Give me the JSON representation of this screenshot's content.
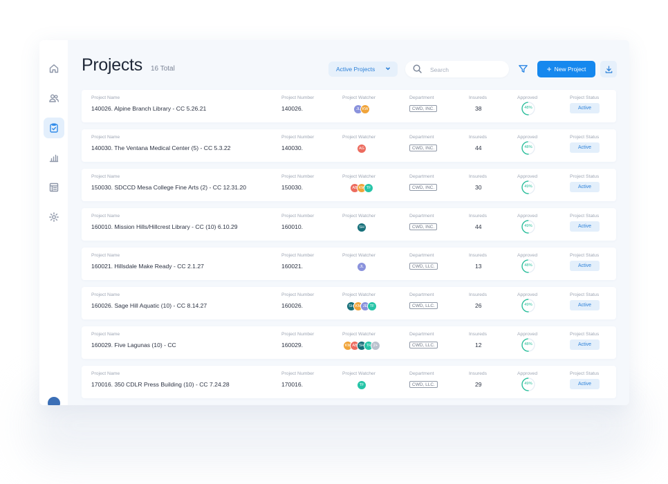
{
  "page": {
    "title": "Projects",
    "total": "16 Total",
    "filter_dropdown": "Active Projects",
    "search_placeholder": "Search",
    "new_project_label": "New Project"
  },
  "sidebar": {
    "items": [
      {
        "icon": "home-icon",
        "active": false
      },
      {
        "icon": "users-icon",
        "active": false
      },
      {
        "icon": "clipboard-check-icon",
        "active": true
      },
      {
        "icon": "bar-chart-icon",
        "active": false
      },
      {
        "icon": "table-list-icon",
        "active": false
      },
      {
        "icon": "settings-icon",
        "active": false
      }
    ]
  },
  "columns": {
    "name": "Project Name",
    "number": "Project Number",
    "watcher": "Project Watcher",
    "department": "Department",
    "insureds": "Insureds",
    "approved": "Approved",
    "status": "Project Status"
  },
  "colors": {
    "accent": "#1688ee",
    "approved_ring": "#2bbf9b"
  },
  "projects": [
    {
      "name": "140026. Alpine Branch Library - CC 5.26.21",
      "number": "140026.",
      "watchers": [
        {
          "initials": "JL",
          "color": "#8a92dc"
        },
        {
          "initials": "KW",
          "color": "#f0a43a"
        }
      ],
      "department": "CWD, INC.",
      "insureds": "38",
      "approved": "48%",
      "approved_value": 0.48,
      "status": "Active"
    },
    {
      "name": "140030. The Ventana Medical Center (5) - CC 5.3.22",
      "number": "140030.",
      "watchers": [
        {
          "initials": "AG",
          "color": "#ec6b5e"
        }
      ],
      "department": "CWD, INC.",
      "insureds": "44",
      "approved": "48%",
      "approved_value": 0.48,
      "status": "Active"
    },
    {
      "name": "150030.  SDCCD Mesa College Fine Arts  (2) - CC 12.31.20",
      "number": "150030.",
      "watchers": [
        {
          "initials": "AB",
          "color": "#ec6b5e"
        },
        {
          "initials": "KM",
          "color": "#f0a43a"
        },
        {
          "initials": "TF",
          "color": "#26c4a7"
        }
      ],
      "department": "CWD, INC.",
      "insureds": "30",
      "approved": "49%",
      "approved_value": 0.49,
      "status": "Active"
    },
    {
      "name": "160010. Mission Hills/Hillcrest Library - CC (10) 6.10.29",
      "number": "160010.",
      "watchers": [
        {
          "initials": "SH",
          "color": "#17707a"
        }
      ],
      "department": "CWD, INC.",
      "insureds": "44",
      "approved": "49%",
      "approved_value": 0.49,
      "status": "Active"
    },
    {
      "name": "160021. Hillsdale Make Ready - CC 2.1.27",
      "number": "160021.",
      "watchers": [
        {
          "initials": "JL",
          "color": "#8a92dc"
        }
      ],
      "department": "CWD, LLC.",
      "insureds": "13",
      "approved": "48%",
      "approved_value": 0.48,
      "status": "Active"
    },
    {
      "name": "160026. Sage Hill Aquatic (10) - CC 8.14.27",
      "number": "160026.",
      "watchers": [
        {
          "initials": "SH",
          "color": "#17707a"
        },
        {
          "initials": "KM",
          "color": "#f0a43a"
        },
        {
          "initials": "JE",
          "color": "#8a92dc"
        },
        {
          "initials": "TF",
          "color": "#26c4a7"
        }
      ],
      "department": "CWD, LLC.",
      "insureds": "26",
      "approved": "49%",
      "approved_value": 0.49,
      "status": "Active"
    },
    {
      "name": "160029. Five Lagunas (10) - CC",
      "number": "160029.",
      "watchers": [
        {
          "initials": "KM",
          "color": "#f0a43a"
        },
        {
          "initials": "AB",
          "color": "#ec6b5e"
        },
        {
          "initials": "SH",
          "color": "#17707a"
        },
        {
          "initials": "TF",
          "color": "#26c4a7"
        },
        {
          "initials": "2+",
          "color": "#b9c1cd"
        }
      ],
      "department": "CWD, LLC.",
      "insureds": "12",
      "approved": "48%",
      "approved_value": 0.48,
      "status": "Active"
    },
    {
      "name": "170016.  350 CDLR Press Building (10) - CC 7.24.28",
      "number": "170016.",
      "watchers": [
        {
          "initials": "TF",
          "color": "#26c4a7"
        }
      ],
      "department": "CWD, LLC.",
      "insureds": "29",
      "approved": "49%",
      "approved_value": 0.49,
      "status": "Active"
    }
  ]
}
